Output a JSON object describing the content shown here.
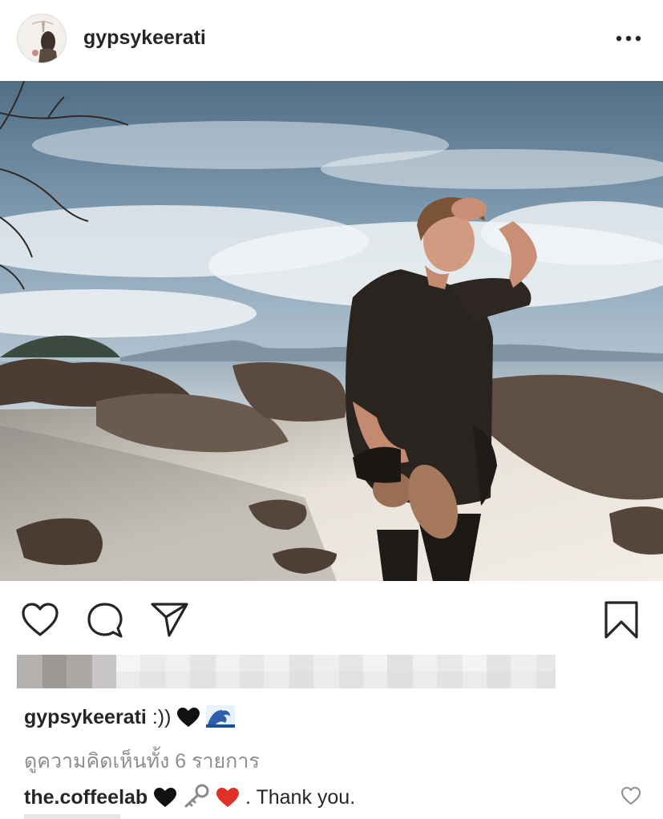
{
  "post": {
    "username": "gypsykeerati",
    "more_icon": "more-horizontal-icon"
  },
  "actions": {
    "like_icon": "heart-outline-icon",
    "comment_icon": "comment-bubble-icon",
    "share_icon": "paper-plane-icon",
    "save_icon": "bookmark-icon"
  },
  "caption": {
    "username": "gypsykeerati",
    "text": ":))",
    "emojis": [
      "black-heart-emoji",
      "wave-emoji"
    ]
  },
  "view_comments": "ดูความคิดเห็นทั้ง 6 รายการ",
  "comment": {
    "username": "the.coffeelab",
    "emojis": [
      "black-heart-emoji",
      "key-emoji",
      "red-heart-emoji"
    ],
    "text": ". Thank you.",
    "like_icon": "heart-outline-icon"
  },
  "colors": {
    "text": "#262626",
    "secondary_text": "#8e8e8e",
    "border": "#dbdbdb",
    "heart_red": "#e0302a"
  }
}
